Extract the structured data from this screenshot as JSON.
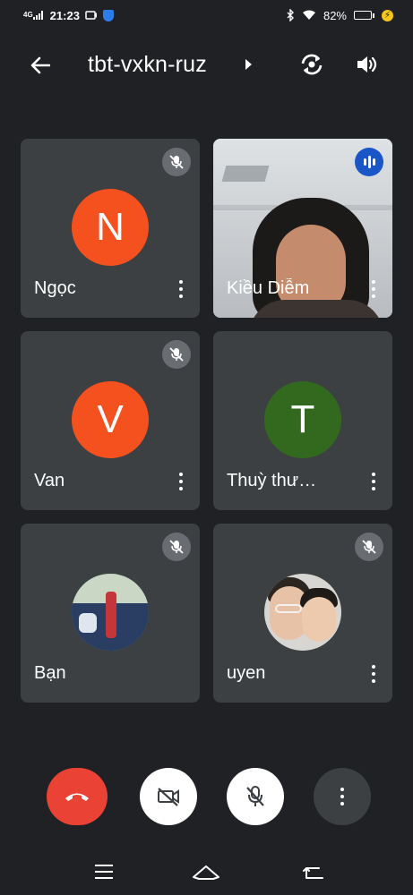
{
  "status_bar": {
    "network": "4G",
    "time": "21:23",
    "battery_percent": "82%",
    "battery_level": 0.82,
    "icons": [
      "signal-icon",
      "screen-cast-icon",
      "shield-app-icon",
      "bluetooth-icon",
      "wifi-icon",
      "battery-icon",
      "charging-icon"
    ]
  },
  "header": {
    "meeting_code": "tbt-vxkn-ruz"
  },
  "participants": [
    {
      "name": "Ngọc",
      "initial": "N",
      "avatar_color": "#f4511e",
      "muted": true,
      "kind": "initial"
    },
    {
      "name": "Kiều Diễm",
      "initial": "",
      "avatar_color": "",
      "muted": false,
      "speaking": true,
      "kind": "video"
    },
    {
      "name": "Van",
      "initial": "V",
      "avatar_color": "#f4511e",
      "muted": true,
      "kind": "initial"
    },
    {
      "name": "Thuỳ thư…",
      "initial": "T",
      "avatar_color": "#33691e",
      "muted": false,
      "kind": "initial"
    },
    {
      "name": "Bạn",
      "initial": "",
      "avatar_color": "",
      "muted": true,
      "kind": "photo"
    },
    {
      "name": "uyen",
      "initial": "",
      "avatar_color": "",
      "muted": true,
      "kind": "photo"
    }
  ],
  "controls": {
    "colors": {
      "hangup": "#ea4335",
      "background": "#202124",
      "tile": "#3c4043",
      "speaking": "#1a56c8"
    }
  }
}
